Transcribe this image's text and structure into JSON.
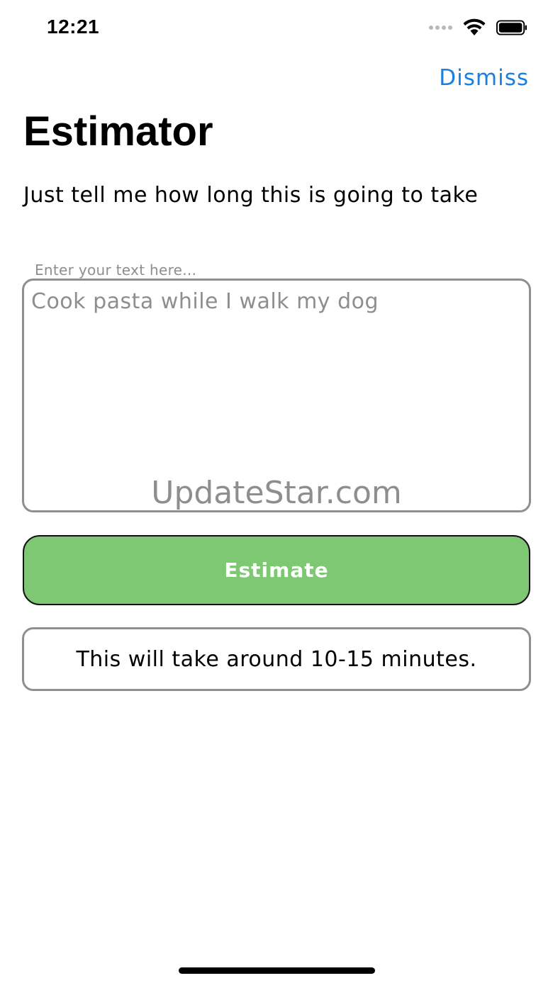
{
  "status_bar": {
    "time": "12:21",
    "icons": [
      "cellular-signal-icon",
      "wifi-icon",
      "battery-icon"
    ]
  },
  "header": {
    "dismiss_label": "Dismiss",
    "title": "Estimator",
    "subtitle": "Just tell me how long this is going to take"
  },
  "input": {
    "label": "Enter your text here...",
    "value": "Cook pasta while I walk my dog"
  },
  "watermark": "UpdateStar.com",
  "estimate_button": {
    "label": "Estimate"
  },
  "result": {
    "text": "This will take around 10-15 minutes."
  },
  "colors": {
    "accent": "#1a7fe0",
    "button": "#7ec873",
    "border": "#8f8f8f",
    "muted_text": "#8e8e8e"
  }
}
